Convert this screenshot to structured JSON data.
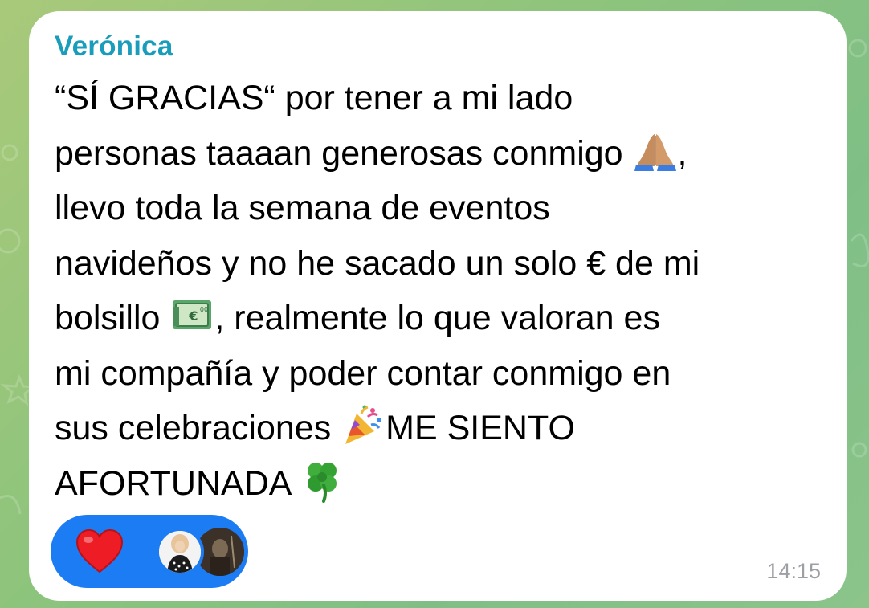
{
  "chat": {
    "wallpaper": "green doodle pattern",
    "accent_color": "#1a9dbb",
    "bubble_color": "#ffffff"
  },
  "message": {
    "sender_name": "Verónica",
    "lines": [
      "“SÍ GRACIAS“  por tener a mi lado",
      "personas taaaan generosas conmigo ",
      ",",
      "llevo toda la semana de eventos",
      "navideños y no he sacado un solo € de mi",
      "bolsillo ",
      ", realmente lo que valoran es",
      "mi compañía y poder contar conmigo en",
      "sus celebraciones ",
      "ME SIENTO",
      "AFORTUNADA "
    ],
    "emojis": {
      "pray": "folded-hands-emoji",
      "money": "euro-banknote-emoji",
      "party": "party-popper-emoji",
      "clover": "four-leaf-clover-emoji"
    },
    "time": "14:15"
  },
  "reactions": {
    "emoji": "red-heart-icon",
    "color": "#1c7cf3",
    "reactors": [
      "avatar-woman-portrait",
      "avatar-dark-photo"
    ]
  }
}
